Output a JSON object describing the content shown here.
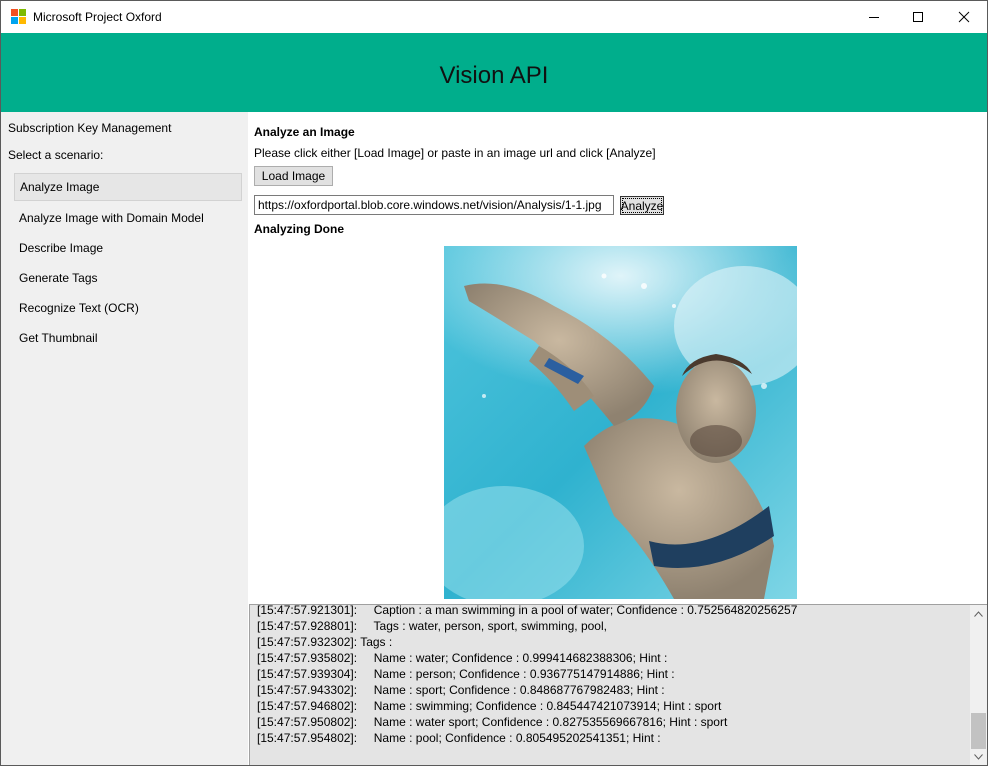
{
  "window": {
    "title": "Microsoft Project Oxford",
    "accent": "#00ae8c",
    "logo_colors": [
      "#f25022",
      "#7fba00",
      "#00a4ef",
      "#ffb900"
    ]
  },
  "header": {
    "title": "Vision API"
  },
  "sidebar": {
    "link": "Subscription Key Management",
    "prompt": "Select a scenario:",
    "selected_index": 0,
    "items": [
      "Analyze Image",
      "Analyze Image with Domain Model",
      "Describe Image",
      "Generate Tags",
      "Recognize Text (OCR)",
      "Get Thumbnail"
    ]
  },
  "main": {
    "section_title": "Analyze an Image",
    "instructions": "Please click either [Load Image] or paste in an image url and click [Analyze]",
    "load_button": "Load Image",
    "url_value": "https://oxfordportal.blob.core.windows.net/vision/Analysis/1-1.jpg",
    "analyze_button": "Analyze",
    "status": "Analyzing Done"
  },
  "log": {
    "lines": [
      "[15:47:57.921301]:     Caption : a man swimming in a pool of water; Confidence : 0.752564820256257",
      "[15:47:57.928801]:     Tags : water, person, sport, swimming, pool,",
      "[15:47:57.932302]: Tags :",
      "[15:47:57.935802]:     Name : water; Confidence : 0.999414682388306; Hint :",
      "[15:47:57.939304]:     Name : person; Confidence : 0.936775147914886; Hint :",
      "[15:47:57.943302]:     Name : sport; Confidence : 0.848687767982483; Hint :",
      "[15:47:57.946802]:     Name : swimming; Confidence : 0.845447421073914; Hint : sport",
      "[15:47:57.950802]:     Name : water sport; Confidence : 0.827535569667816; Hint : sport",
      "[15:47:57.954802]:     Name : pool; Confidence : 0.805495202541351; Hint :"
    ]
  }
}
